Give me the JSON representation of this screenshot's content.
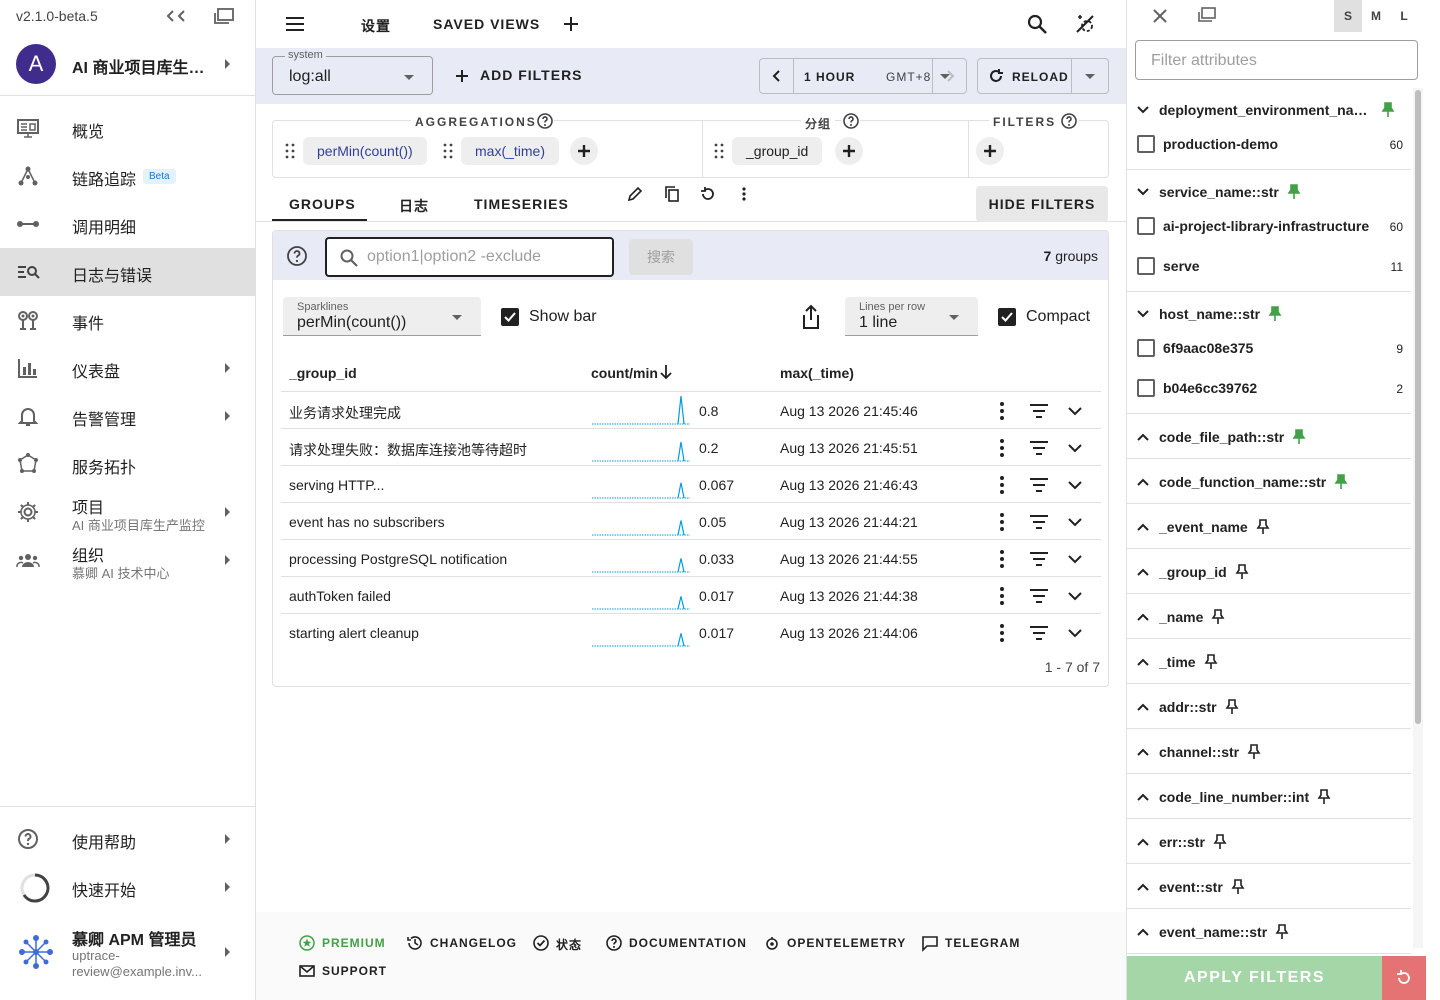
{
  "sidebar": {
    "version": "v2.1.0-beta.5",
    "project": {
      "avatar_letter": "A",
      "name": "AI 商业项目库生产监控"
    },
    "nav": [
      {
        "label": "概览",
        "icon": "dashboard-monitor-icon"
      },
      {
        "label": "链路追踪",
        "icon": "tracing-icon",
        "badge": "Beta"
      },
      {
        "label": "调用明细",
        "icon": "spans-icon"
      },
      {
        "label": "日志与错误",
        "icon": "logs-search-icon",
        "active": true
      },
      {
        "label": "事件",
        "icon": "events-icon"
      },
      {
        "label": "仪表盘",
        "icon": "bar-chart-icon"
      },
      {
        "label": "告警管理",
        "icon": "bell-icon"
      },
      {
        "label": "服务拓扑",
        "icon": "service-graph-icon"
      },
      {
        "label": "项目",
        "sub": "AI 商业项目库生产监控",
        "icon": "gear-icon"
      },
      {
        "label": "组织",
        "sub": "慕卿 AI 技术中心",
        "icon": "people-icon"
      }
    ],
    "help": "使用帮助",
    "quickstart": "快速开始",
    "user": {
      "name": "慕卿 APM 管理员",
      "email": "uptrace-review@example.inv..."
    }
  },
  "header": {
    "settings": "设置",
    "saved_views": "SAVED VIEWS"
  },
  "toolbar": {
    "system_label": "system",
    "system_value": "log:all",
    "add_filters": "ADD FILTERS",
    "period": "1 HOUR",
    "timezone": "GMT+8",
    "reload": "RELOAD"
  },
  "query": {
    "aggregations_title": "AGGREGATIONS",
    "aggregations": [
      "perMin(count())",
      "max(_time)"
    ],
    "group_title": "分组",
    "group_by": [
      "_group_id"
    ],
    "filters_title": "FILTERS"
  },
  "tabs": {
    "items": [
      "GROUPS",
      "日志",
      "TIMESERIES"
    ],
    "active": "GROUPS",
    "hide_filters": "HIDE FILTERS"
  },
  "groups": {
    "search_placeholder": "option1|option2 -exclude",
    "search_button": "搜索",
    "count": "7",
    "count_suffix": "groups",
    "sparklines_label": "Sparklines",
    "sparklines_value": "perMin(count())",
    "show_bar": "Show bar",
    "show_bar_checked": true,
    "lines_per_row_label": "Lines per row",
    "lines_per_row_value": "1 line",
    "compact": "Compact",
    "compact_checked": true,
    "columns": [
      "_group_id",
      "count/min",
      "max(_time)"
    ],
    "sort_column": "count/min",
    "sort_direction": "desc",
    "spark_color": "#039be5",
    "rows": [
      {
        "group_id": "业务请求处理完成",
        "count": "0.8",
        "time": "Aug 13 2026 21:45:46"
      },
      {
        "group_id": "请求处理失败：数据库连接池等待超时",
        "count": "0.2",
        "time": "Aug 13 2026 21:45:51"
      },
      {
        "group_id": "serving HTTP...",
        "count": "0.067",
        "time": "Aug 13 2026 21:46:43"
      },
      {
        "group_id": "event has no subscribers",
        "count": "0.05",
        "time": "Aug 13 2026 21:44:21"
      },
      {
        "group_id": "processing PostgreSQL notification",
        "count": "0.033",
        "time": "Aug 13 2026 21:44:55"
      },
      {
        "group_id": "authToken failed",
        "count": "0.017",
        "time": "Aug 13 2026 21:44:38"
      },
      {
        "group_id": "starting alert cleanup",
        "count": "0.017",
        "time": "Aug 13 2026 21:44:06"
      }
    ],
    "pager": "1 - 7 of 7"
  },
  "footer": {
    "links": [
      "PREMIUM",
      "CHANGELOG",
      "状态",
      "DOCUMENTATION",
      "OPENTELEMETRY",
      "TELEGRAM",
      "SUPPORT"
    ],
    "premium_color": "#43a047"
  },
  "attr_panel": {
    "sizes": [
      "S",
      "M",
      "L"
    ],
    "active_size": "S",
    "filter_placeholder": "Filter attributes",
    "pinned_color": "#43a047",
    "sections": [
      {
        "name": "deployment_environment_name::str",
        "expanded": true,
        "pinned": true,
        "values": [
          {
            "value": "production-demo",
            "count": "60"
          }
        ]
      },
      {
        "name": "service_name::str",
        "expanded": true,
        "pinned": true,
        "values": [
          {
            "value": "ai-project-library-infrastructure",
            "count": "60"
          },
          {
            "value": "serve",
            "count": "11"
          }
        ]
      },
      {
        "name": "host_name::str",
        "expanded": true,
        "pinned": true,
        "values": [
          {
            "value": "6f9aac08e375",
            "count": "9"
          },
          {
            "value": "b04e6cc39762",
            "count": "2"
          }
        ]
      },
      {
        "name": "code_file_path::str",
        "pinned": true
      },
      {
        "name": "code_function_name::str",
        "pinned": true
      },
      {
        "name": "_event_name"
      },
      {
        "name": "_group_id"
      },
      {
        "name": "_name"
      },
      {
        "name": "_time"
      },
      {
        "name": "addr::str"
      },
      {
        "name": "channel::str"
      },
      {
        "name": "code_line_number::int"
      },
      {
        "name": "err::str"
      },
      {
        "name": "event::str"
      },
      {
        "name": "event_name::str"
      }
    ],
    "apply": "APPLY FILTERS"
  }
}
